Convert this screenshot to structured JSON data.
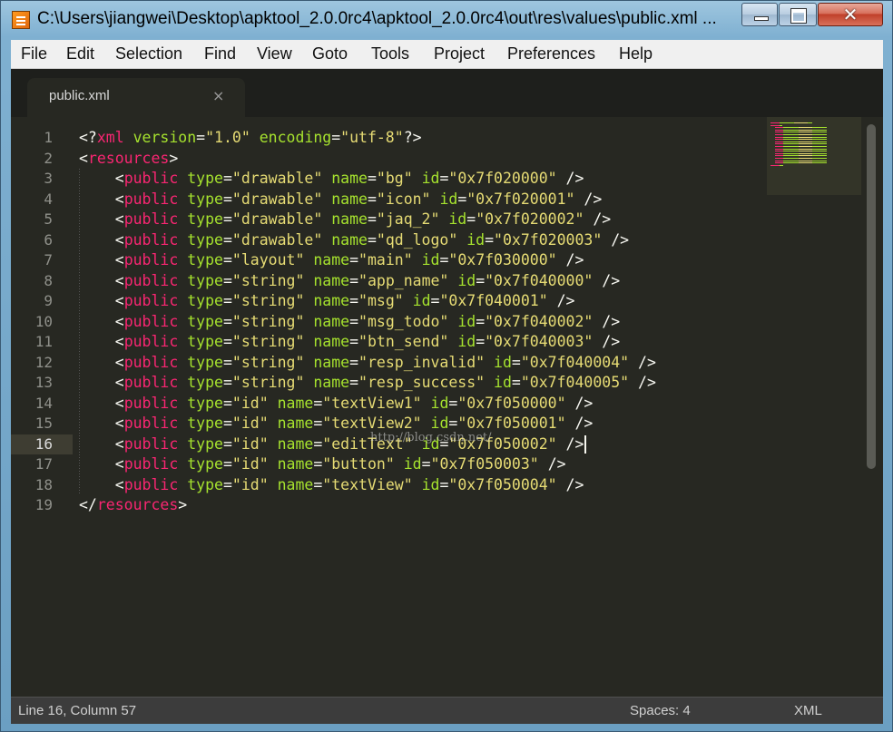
{
  "window": {
    "title": "C:\\Users\\jiangwei\\Desktop\\apktool_2.0.0rc4\\apktool_2.0.0rc4\\out\\res\\values\\public.xml ..."
  },
  "controls": {
    "minimize": "—",
    "maximize": "□",
    "close": "✕"
  },
  "menu": [
    "File",
    "Edit",
    "Selection",
    "Find",
    "View",
    "Goto",
    "Tools",
    "Project",
    "Preferences",
    "Help"
  ],
  "tab": {
    "label": "public.xml",
    "close": "×"
  },
  "gutter": {
    "active_line": 16,
    "line_count": 19
  },
  "code_lines": [
    "<?xml version=\"1.0\" encoding=\"utf-8\"?>",
    "<resources>",
    "    <public type=\"drawable\" name=\"bg\" id=\"0x7f020000\" />",
    "    <public type=\"drawable\" name=\"icon\" id=\"0x7f020001\" />",
    "    <public type=\"drawable\" name=\"jaq_2\" id=\"0x7f020002\" />",
    "    <public type=\"drawable\" name=\"qd_logo\" id=\"0x7f020003\" />",
    "    <public type=\"layout\" name=\"main\" id=\"0x7f030000\" />",
    "    <public type=\"string\" name=\"app_name\" id=\"0x7f040000\" />",
    "    <public type=\"string\" name=\"msg\" id=\"0x7f040001\" />",
    "    <public type=\"string\" name=\"msg_todo\" id=\"0x7f040002\" />",
    "    <public type=\"string\" name=\"btn_send\" id=\"0x7f040003\" />",
    "    <public type=\"string\" name=\"resp_invalid\" id=\"0x7f040004\" />",
    "    <public type=\"string\" name=\"resp_success\" id=\"0x7f040005\" />",
    "    <public type=\"id\" name=\"textView1\" id=\"0x7f050000\" />",
    "    <public type=\"id\" name=\"textView2\" id=\"0x7f050001\" />",
    "    <public type=\"id\" name=\"editText\" id=\"0x7f050002\" />",
    "    <public type=\"id\" name=\"button\" id=\"0x7f050003\" />",
    "    <public type=\"id\" name=\"textView\" id=\"0x7f050004\" />",
    "</resources>"
  ],
  "watermark": "http://blog.csdn.net/",
  "status": {
    "position": "Line 16, Column 57",
    "indent": "Spaces: 4",
    "syntax": "XML"
  },
  "colors": {
    "tag": "#f92672",
    "attr": "#a6e22e",
    "string": "#e6db74",
    "background": "#272822"
  }
}
